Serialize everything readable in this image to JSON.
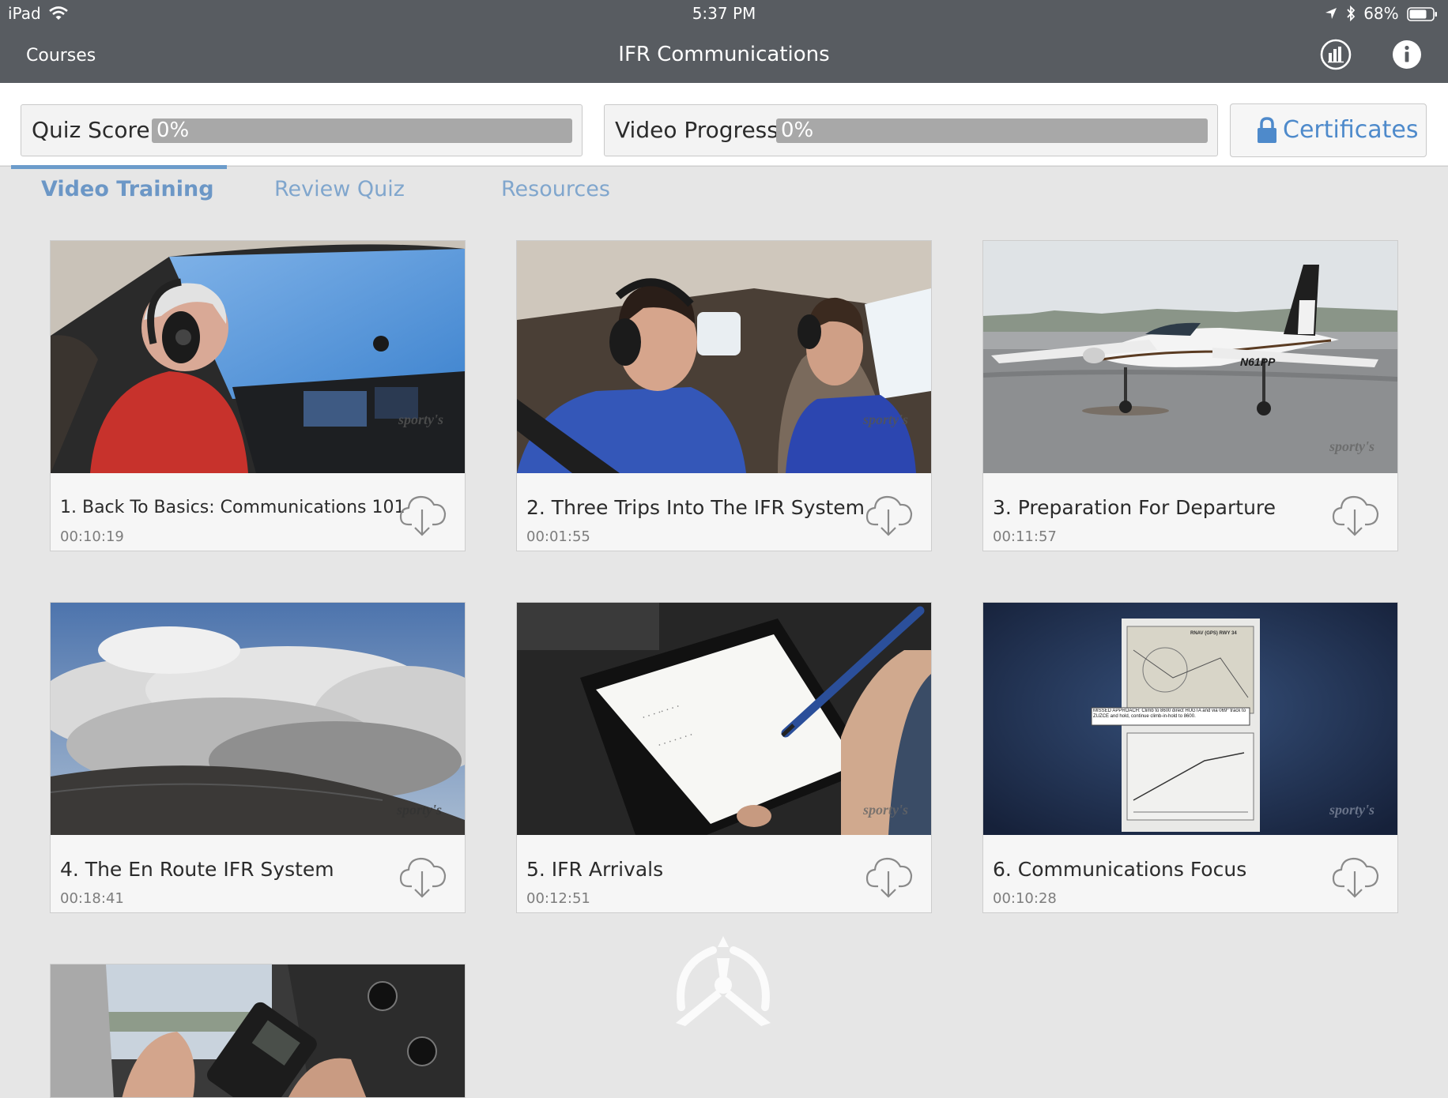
{
  "status_bar": {
    "device": "iPad",
    "time": "5:37 PM",
    "battery": "68%"
  },
  "nav": {
    "back_label": "Courses",
    "title": "IFR Communications",
    "icons": [
      "stats-chart-icon",
      "info-icon"
    ]
  },
  "progress": {
    "quiz_score": {
      "label": "Quiz Score",
      "value": "0%",
      "fraction": 0
    },
    "video_progress": {
      "label": "Video Progress",
      "value": "0%",
      "fraction": 0
    },
    "certificates_label": "Certificates"
  },
  "tabs": [
    {
      "label": "Video Training",
      "active": true
    },
    {
      "label": "Review Quiz",
      "active": false
    },
    {
      "label": "Resources",
      "active": false
    }
  ],
  "videos": [
    {
      "title": "1. Back To Basics: Communications 101",
      "duration": "00:10:19"
    },
    {
      "title": "2. Three Trips Into The IFR System",
      "duration": "00:01:55"
    },
    {
      "title": "3. Preparation For Departure",
      "duration": "00:11:57"
    },
    {
      "title": "4. The En Route IFR System",
      "duration": "00:18:41"
    },
    {
      "title": "5. IFR Arrivals",
      "duration": "00:12:51"
    },
    {
      "title": "6. Communications Focus",
      "duration": "00:10:28"
    }
  ],
  "thumbnail_text": {
    "watermark": "sporty's",
    "tail_number": "N61PP",
    "chart_note": "MISSED APPROACH: Climb to 8600 direct HUGTA and via 069° track to ZUZCE and hold, continue climb-in-hold to 8600.",
    "chart_header": "RNAV (GPS) RWY 34"
  },
  "colors": {
    "header_bg": "#585c61",
    "accent": "#4e8acb",
    "tab_active": "#6c97c6",
    "progress_track": "#a8a8a8"
  }
}
